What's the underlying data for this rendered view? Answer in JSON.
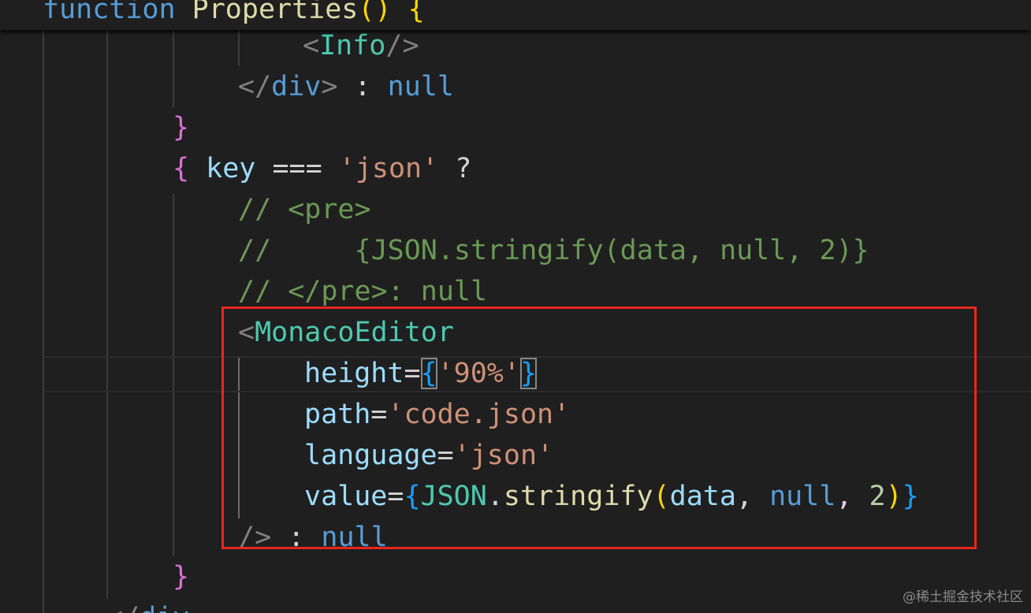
{
  "editor": {
    "background": "#1f1f1f",
    "sticky": {
      "keyword": "function",
      "name": "Properties",
      "parens": "()",
      "brace": "{"
    },
    "lines": {
      "l1": {
        "open": "<",
        "tag": "Info",
        "close": "/>"
      },
      "l2": {
        "open": "</",
        "tag": "div",
        "close": ">",
        "sep": " : ",
        "null": "null"
      },
      "l3": {
        "brace": "}"
      },
      "l4": {
        "brace": "{",
        "var": "key",
        "op": " === ",
        "str": "'json'",
        "q": " ?"
      },
      "l5": {
        "comment": "// <pre>"
      },
      "l6": {
        "comment": "//     {JSON.stringify(data, null, 2)}"
      },
      "l7": {
        "comment": "// </pre>: null"
      },
      "l8": {
        "open": "<",
        "tag": "MonacoEditor"
      },
      "l9": {
        "attr": "height",
        "eq": "=",
        "b1": "{",
        "str": "'90%'",
        "b2": "}"
      },
      "l10": {
        "attr": "path",
        "eq": "=",
        "str": "'code.json'"
      },
      "l11": {
        "attr": "language",
        "eq": "=",
        "str": "'json'"
      },
      "l12": {
        "attr": "value",
        "eq": "=",
        "b1": "{",
        "obj": "JSON",
        "dot": ".",
        "fn": "stringify",
        "p1": "(",
        "arg1": "data",
        "c1": ", ",
        "arg2": "null",
        "c2": ", ",
        "num": "2",
        "p2": ")",
        "b2": "}"
      },
      "l13": {
        "close": "/>",
        "sep": " : ",
        "null": "null"
      },
      "l14": {
        "brace": "}"
      },
      "l15": {
        "open": "</",
        "tag": "div"
      }
    }
  },
  "colors": {
    "keyword": "#569cd6",
    "function": "#dcdcaa",
    "tag": "#4ec9b0",
    "attribute": "#9cdcfe",
    "string": "#ce9178",
    "comment": "#6a9955",
    "number": "#b5cea8",
    "highlight_border": "#e8271e"
  },
  "watermark": "@稀土掘金技术社区"
}
